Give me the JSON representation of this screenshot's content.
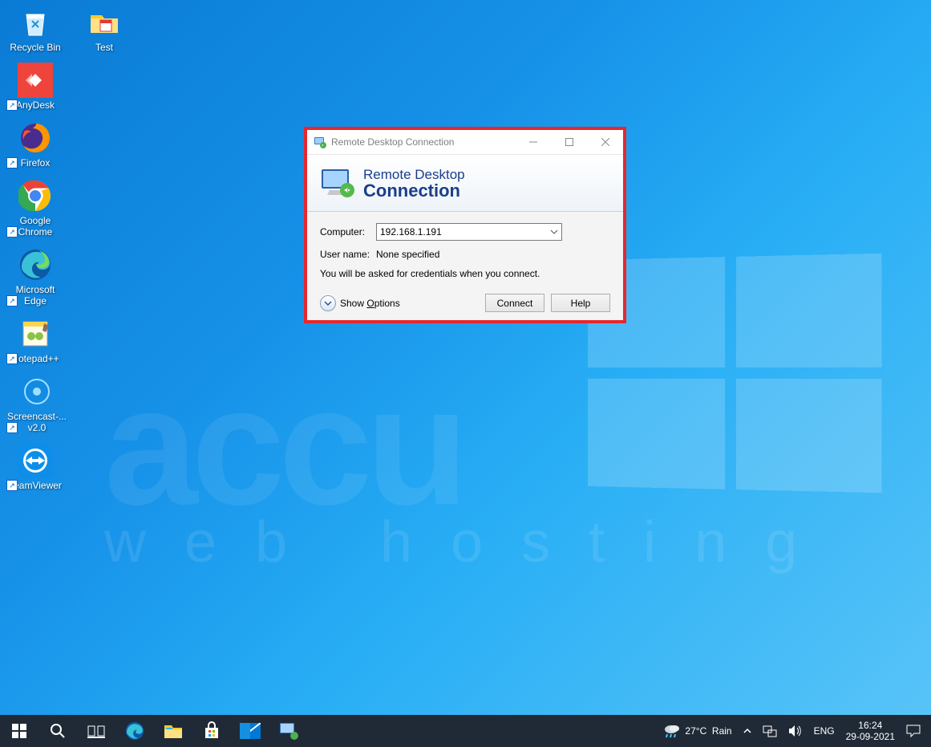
{
  "desktop_icons_col1": [
    {
      "label": "Recycle Bin"
    },
    {
      "label": "AnyDesk"
    },
    {
      "label": "Firefox"
    },
    {
      "label": "Google Chrome"
    },
    {
      "label": "Microsoft Edge"
    },
    {
      "label": "Notepad++"
    },
    {
      "label": "Screencast-... v2.0"
    },
    {
      "label": "TeamViewer"
    }
  ],
  "desktop_icons_col2": [
    {
      "label": "Test"
    }
  ],
  "watermark": {
    "top": "accu",
    "bottom": "web hosting"
  },
  "dialog": {
    "title": "Remote Desktop Connection",
    "banner_line1": "Remote Desktop",
    "banner_line2": "Connection",
    "computer_label": "Computer:",
    "computer_value": "192.168.1.191",
    "username_label": "User name:",
    "username_value": "None specified",
    "hint": "You will be asked for credentials when you connect.",
    "show_options_pre": "Show ",
    "show_options_u": "O",
    "show_options_post": "ptions",
    "connect": "Connect",
    "help": "Help"
  },
  "taskbar": {
    "weather_temp": "27°C",
    "weather_cond": "Rain",
    "lang": "ENG",
    "time": "16:24",
    "date": "29-09-2021"
  }
}
